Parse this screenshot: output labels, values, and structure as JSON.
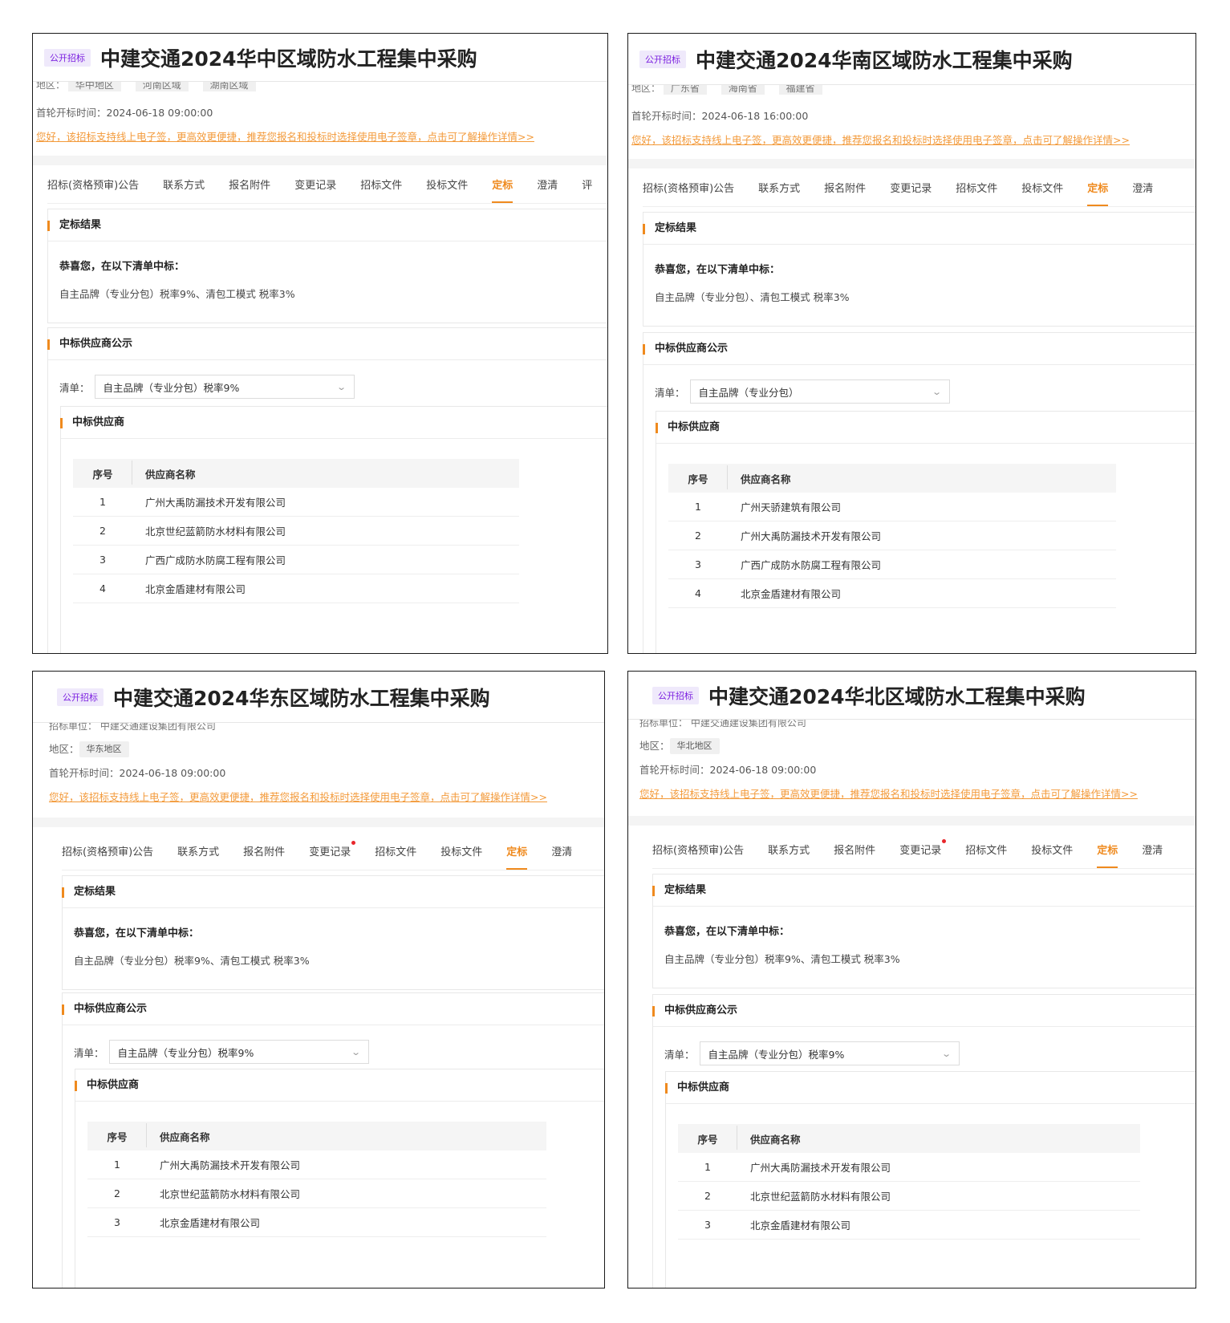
{
  "panels": [
    {
      "badge": "公开招标",
      "title": "中建交通2024华中区域防水工程集中采购",
      "meta_partial": {
        "label": "地区：",
        "chips": [
          "华中地区",
          "河南区域",
          "湖南区域"
        ]
      },
      "meta_region": null,
      "open_time_label": "首轮开标时间：",
      "open_time_value": "2024-06-18 09:00:00",
      "notice": "您好，该招标支持线上电子签，更高效更便捷，推荐您报名和投标时选择使用电子签章，点击可了解操作详情>>",
      "tabs": [
        {
          "label": "招标(资格预审)公告",
          "active": false,
          "dot": false
        },
        {
          "label": "联系方式",
          "active": false,
          "dot": false
        },
        {
          "label": "报名附件",
          "active": false,
          "dot": false
        },
        {
          "label": "变更记录",
          "active": false,
          "dot": false
        },
        {
          "label": "招标文件",
          "active": false,
          "dot": false
        },
        {
          "label": "投标文件",
          "active": false,
          "dot": false
        },
        {
          "label": "定标",
          "active": true,
          "dot": false
        },
        {
          "label": "澄清",
          "active": false,
          "dot": false
        },
        {
          "label": "评",
          "active": false,
          "dot": false
        }
      ],
      "result_title": "定标结果",
      "congrats": "恭喜您，在以下清单中标：",
      "lots": "自主品牌（专业分包）税率9%、清包工模式 税率3%",
      "suppliers_title": "中标供应商公示",
      "list_label": "清单：",
      "list_value": "自主品牌（专业分包）税率9%",
      "winners_title": "中标供应商",
      "table_headers": [
        "序号",
        "供应商名称"
      ],
      "rows": [
        {
          "no": "1",
          "name": "广州大禹防漏技术开发有限公司"
        },
        {
          "no": "2",
          "name": "北京世纪蓝箭防水材料有限公司"
        },
        {
          "no": "3",
          "name": "广西广成防水防腐工程有限公司"
        },
        {
          "no": "4",
          "name": "北京金盾建材有限公司"
        }
      ]
    },
    {
      "badge": "公开招标",
      "title": "中建交通2024华南区域防水工程集中采购",
      "meta_partial": {
        "label": "地区：",
        "chips": [
          "广东省",
          "海南省",
          "福建省"
        ]
      },
      "meta_region": null,
      "open_time_label": "首轮开标时间：",
      "open_time_value": "2024-06-18 16:00:00",
      "notice": "您好，该招标支持线上电子签，更高效更便捷，推荐您报名和投标时选择使用电子签章，点击可了解操作详情>>",
      "tabs": [
        {
          "label": "招标(资格预审)公告",
          "active": false,
          "dot": false
        },
        {
          "label": "联系方式",
          "active": false,
          "dot": false
        },
        {
          "label": "报名附件",
          "active": false,
          "dot": false
        },
        {
          "label": "变更记录",
          "active": false,
          "dot": false
        },
        {
          "label": "招标文件",
          "active": false,
          "dot": false
        },
        {
          "label": "投标文件",
          "active": false,
          "dot": false
        },
        {
          "label": "定标",
          "active": true,
          "dot": false
        },
        {
          "label": "澄清",
          "active": false,
          "dot": false
        }
      ],
      "result_title": "定标结果",
      "congrats": "恭喜您，在以下清单中标：",
      "lots": "自主品牌（专业分包）、清包工模式 税率3%",
      "suppliers_title": "中标供应商公示",
      "list_label": "清单：",
      "list_value": "自主品牌（专业分包）",
      "winners_title": "中标供应商",
      "table_headers": [
        "序号",
        "供应商名称"
      ],
      "rows": [
        {
          "no": "1",
          "name": "广州天骄建筑有限公司"
        },
        {
          "no": "2",
          "name": "广州大禹防漏技术开发有限公司"
        },
        {
          "no": "3",
          "name": "广西广成防水防腐工程有限公司"
        },
        {
          "no": "4",
          "name": "北京金盾建材有限公司"
        }
      ]
    },
    {
      "badge": "公开招标",
      "title": "中建交通2024华东区域防水工程集中采购",
      "meta_partial": {
        "label": "招标单位：",
        "chips": [],
        "text": "中建交通建设集团有限公司"
      },
      "meta_region": {
        "label": "地区：",
        "chip": "华东地区"
      },
      "open_time_label": "首轮开标时间：",
      "open_time_value": "2024-06-18 09:00:00",
      "notice": "您好，该招标支持线上电子签，更高效更便捷，推荐您报名和投标时选择使用电子签章，点击可了解操作详情>>",
      "tabs": [
        {
          "label": "招标(资格预审)公告",
          "active": false,
          "dot": false
        },
        {
          "label": "联系方式",
          "active": false,
          "dot": false
        },
        {
          "label": "报名附件",
          "active": false,
          "dot": false
        },
        {
          "label": "变更记录",
          "active": false,
          "dot": true
        },
        {
          "label": "招标文件",
          "active": false,
          "dot": false
        },
        {
          "label": "投标文件",
          "active": false,
          "dot": false
        },
        {
          "label": "定标",
          "active": true,
          "dot": false
        },
        {
          "label": "澄清",
          "active": false,
          "dot": false
        }
      ],
      "result_title": "定标结果",
      "congrats": "恭喜您，在以下清单中标：",
      "lots": "自主品牌（专业分包）税率9%、清包工模式 税率3%",
      "suppliers_title": "中标供应商公示",
      "list_label": "清单：",
      "list_value": "自主品牌（专业分包）税率9%",
      "winners_title": "中标供应商",
      "table_headers": [
        "序号",
        "供应商名称"
      ],
      "rows": [
        {
          "no": "1",
          "name": "广州大禹防漏技术开发有限公司"
        },
        {
          "no": "2",
          "name": "北京世纪蓝箭防水材料有限公司"
        },
        {
          "no": "3",
          "name": "北京金盾建材有限公司"
        }
      ]
    },
    {
      "badge": "公开招标",
      "title": "中建交通2024华北区域防水工程集中采购",
      "meta_partial": {
        "label": "招标单位：",
        "chips": [],
        "text": "中建交通建设集团有限公司"
      },
      "meta_region": {
        "label": "地区：",
        "chip": "华北地区"
      },
      "open_time_label": "首轮开标时间：",
      "open_time_value": "2024-06-18 09:00:00",
      "notice": "您好，该招标支持线上电子签，更高效更便捷，推荐您报名和投标时选择使用电子签章，点击可了解操作详情>>",
      "tabs": [
        {
          "label": "招标(资格预审)公告",
          "active": false,
          "dot": false
        },
        {
          "label": "联系方式",
          "active": false,
          "dot": false
        },
        {
          "label": "报名附件",
          "active": false,
          "dot": false
        },
        {
          "label": "变更记录",
          "active": false,
          "dot": true
        },
        {
          "label": "招标文件",
          "active": false,
          "dot": false
        },
        {
          "label": "投标文件",
          "active": false,
          "dot": false
        },
        {
          "label": "定标",
          "active": true,
          "dot": false
        },
        {
          "label": "澄清",
          "active": false,
          "dot": false
        }
      ],
      "result_title": "定标结果",
      "congrats": "恭喜您，在以下清单中标：",
      "lots": "自主品牌（专业分包）税率9%、清包工模式 税率3%",
      "suppliers_title": "中标供应商公示",
      "list_label": "清单：",
      "list_value": "自主品牌（专业分包）税率9%",
      "winners_title": "中标供应商",
      "table_headers": [
        "序号",
        "供应商名称"
      ],
      "rows": [
        {
          "no": "1",
          "name": "广州大禹防漏技术开发有限公司"
        },
        {
          "no": "2",
          "name": "北京世纪蓝箭防水材料有限公司"
        },
        {
          "no": "3",
          "name": "北京金盾建材有限公司"
        }
      ]
    }
  ],
  "colors": {
    "accent": "#ef8a1e",
    "notice": "#f39a3a",
    "badge_text": "#7b1fe0",
    "badge_bg": "#efe9fb",
    "dot": "#e8262b"
  }
}
